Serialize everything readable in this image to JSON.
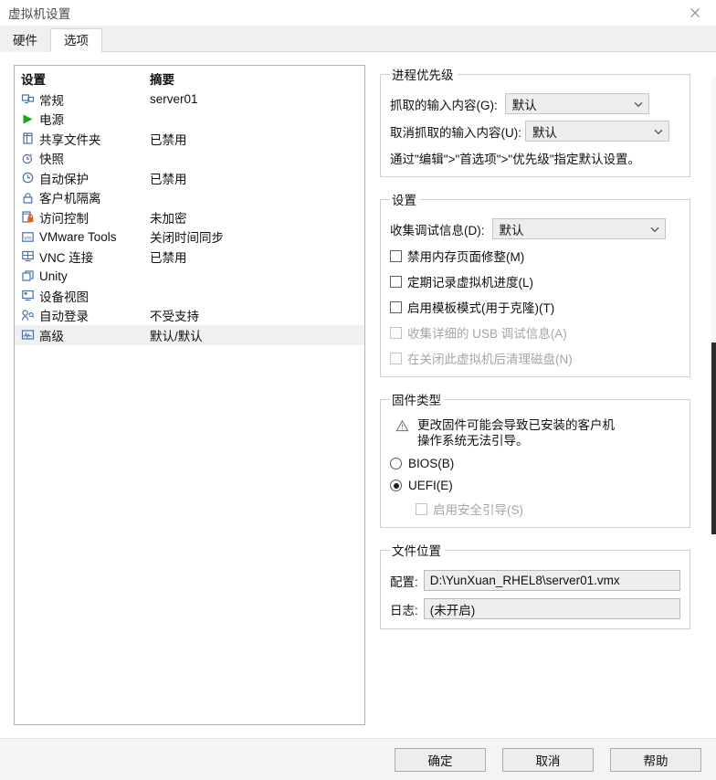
{
  "window": {
    "title": "虚拟机设置",
    "close_icon": "close-icon"
  },
  "tabs": [
    {
      "label": "硬件",
      "active": false
    },
    {
      "label": "选项",
      "active": true
    }
  ],
  "settings_list": {
    "headers": {
      "setting": "设置",
      "summary": "摘要"
    },
    "rows": [
      {
        "icon": "monitor-icon",
        "label": "常规",
        "summary": "server01",
        "selected": false
      },
      {
        "icon": "power-play-icon",
        "label": "电源",
        "summary": "",
        "selected": false
      },
      {
        "icon": "folder-icon",
        "label": "共享文件夹",
        "summary": "已禁用",
        "selected": false
      },
      {
        "icon": "snapshot-icon",
        "label": "快照",
        "summary": "",
        "selected": false
      },
      {
        "icon": "clock-icon",
        "label": "自动保护",
        "summary": "已禁用",
        "selected": false
      },
      {
        "icon": "lock-icon",
        "label": "客户机隔离",
        "summary": "",
        "selected": false
      },
      {
        "icon": "access-lock-icon",
        "label": "访问控制",
        "summary": "未加密",
        "selected": false
      },
      {
        "icon": "vmware-tools-icon",
        "label": "VMware Tools",
        "summary": "关闭时间同步",
        "selected": false
      },
      {
        "icon": "vnc-icon",
        "label": "VNC 连接",
        "summary": "已禁用",
        "selected": false
      },
      {
        "icon": "unity-icon",
        "label": "Unity",
        "summary": "",
        "selected": false
      },
      {
        "icon": "device-view-icon",
        "label": "设备视图",
        "summary": "",
        "selected": false
      },
      {
        "icon": "auto-login-icon",
        "label": "自动登录",
        "summary": "不受支持",
        "selected": false
      },
      {
        "icon": "advanced-icon",
        "label": "高级",
        "summary": "默认/默认",
        "selected": true
      }
    ]
  },
  "process_priority": {
    "legend": "进程优先级",
    "grab_label": "抓取的输入内容(G):",
    "grab_value": "默认",
    "ungrab_label": "取消抓取的输入内容(U):",
    "ungrab_value": "默认",
    "note": "通过\"编辑\">\"首选项\">\"优先级\"指定默认设置。"
  },
  "settings_group": {
    "legend": "设置",
    "debug_label": "收集调试信息(D):",
    "debug_value": "默认",
    "checkboxes": [
      {
        "label": "禁用内存页面修整(M)",
        "checked": false,
        "disabled": false
      },
      {
        "label": "定期记录虚拟机进度(L)",
        "checked": false,
        "disabled": false
      },
      {
        "label": "启用模板模式(用于克隆)(T)",
        "checked": false,
        "disabled": false
      },
      {
        "label": "收集详细的 USB 调试信息(A)",
        "checked": false,
        "disabled": true
      },
      {
        "label": "在关闭此虚拟机后清理磁盘(N)",
        "checked": false,
        "disabled": true
      }
    ]
  },
  "firmware": {
    "legend": "固件类型",
    "warning_icon": "warning-triangle-icon",
    "warning_line1": "更改固件可能会导致已安装的客户机",
    "warning_line2": "操作系统无法引导。",
    "options": [
      {
        "label": "BIOS(B)",
        "checked": false
      },
      {
        "label": "UEFI(E)",
        "checked": true
      }
    ],
    "secure_boot": {
      "label": "启用安全引导(S)",
      "checked": false,
      "disabled": true
    }
  },
  "file_location": {
    "legend": "文件位置",
    "config_label": "配置:",
    "config_value": "D:\\YunXuan_RHEL8\\server01.vmx",
    "log_label": "日志:",
    "log_value": "(未开启)"
  },
  "footer": {
    "ok": "确定",
    "cancel": "取消",
    "help": "帮助"
  },
  "colors": {
    "power_green": "#19a319",
    "access_lock_orange": "#e06010",
    "accent_blue": "#3a5fa8",
    "selected_row": "#f0f0f0"
  }
}
